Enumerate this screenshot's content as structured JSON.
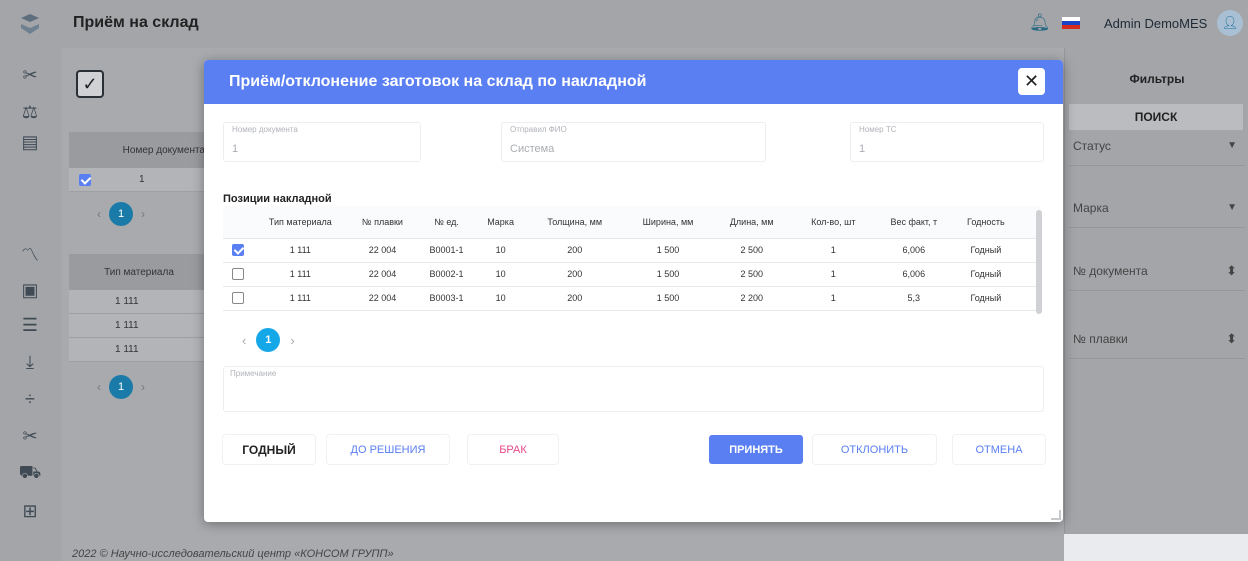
{
  "app": {
    "page_title": "Приём на склад",
    "user_name": "Admin DemoMES",
    "footer": "2022 © Научно-исследовательский центр «КОНСОМ ГРУПП»"
  },
  "colors": {
    "modal_header": "#5a7ff2",
    "accent_blue": "#15a8e8",
    "reject_pink": "#e64a8a",
    "primary_button": "#5a7ff2"
  },
  "sidebar_icons": [
    "logo-icon",
    "scissors-icon",
    "scale-icon",
    "archive-icon",
    "chart-icon",
    "monitor-icon",
    "list-icon",
    "download-icon",
    "divide-icon",
    "scissors-icon",
    "truck-icon",
    "book-icon"
  ],
  "background": {
    "doc_table_header": "Номер документа",
    "doc_table_row": "1",
    "page": "1",
    "material_header": "Тип материала",
    "material_rows": [
      "1 111",
      "1 111",
      "1 111"
    ]
  },
  "filters": {
    "title": "Фильтры",
    "search": "ПОИСК",
    "status": "Статус",
    "brand": "Марка",
    "doc_number": "№ документа",
    "melt_number": "№ плавки"
  },
  "modal": {
    "title": "Приём/отклонение заготовок на склад по накладной",
    "fields": {
      "doc_number_label": "Номер документа",
      "doc_number_value": "1",
      "sender_label": "Отправил ФИО",
      "sender_value": "Система",
      "vehicle_label": "Номер ТС",
      "vehicle_value": "1"
    },
    "section_title": "Позиции накладной",
    "table": {
      "headers": [
        "Тип материала",
        "№ плавки",
        "№ ед.",
        "Марка",
        "Толщина, мм",
        "Ширина, мм",
        "Длина, мм",
        "Кол-во, шт",
        "Вес факт, т",
        "Годность"
      ],
      "rows": [
        {
          "checked": true,
          "cells": [
            "1 111",
            "22 004",
            "B0001-1",
            "10",
            "200",
            "1 500",
            "2 500",
            "1",
            "6,006",
            "Годный"
          ]
        },
        {
          "checked": false,
          "cells": [
            "1 111",
            "22 004",
            "B0002-1",
            "10",
            "200",
            "1 500",
            "2 500",
            "1",
            "6,006",
            "Годный"
          ]
        },
        {
          "checked": false,
          "cells": [
            "1 111",
            "22 004",
            "B0003-1",
            "10",
            "200",
            "1 500",
            "2 200",
            "1",
            "5,3",
            "Годный"
          ]
        }
      ]
    },
    "page": "1",
    "note_label": "Примечание",
    "buttons": {
      "good": "ГОДНЫЙ",
      "pending": "ДО РЕШЕНИЯ",
      "defect": "БРАК",
      "accept": "ПРИНЯТЬ",
      "reject": "ОТКЛОНИТЬ",
      "cancel": "ОТМЕНА"
    }
  }
}
